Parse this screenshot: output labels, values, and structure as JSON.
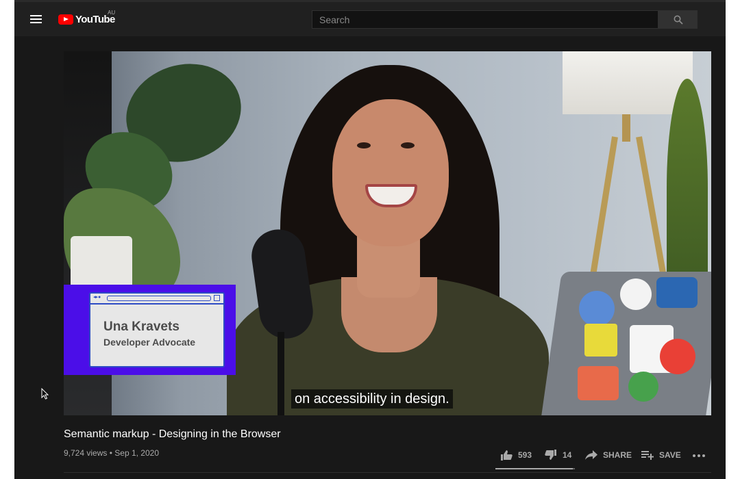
{
  "header": {
    "logo_text": "YouTube",
    "country_code": "AU",
    "search_placeholder": "Search"
  },
  "video": {
    "lower_third": {
      "name": "Una Kravets",
      "role": "Developer Advocate"
    },
    "caption": "on accessibility in design.",
    "title": "Semantic markup - Designing in the Browser",
    "views": "9,724 views",
    "date": "Sep 1, 2020",
    "separator": "•"
  },
  "actions": {
    "likes": "593",
    "dislikes": "14",
    "share_label": "SHARE",
    "save_label": "SAVE",
    "like_ratio": 0.977
  },
  "icons": [
    "menu-icon",
    "youtube-logo-icon",
    "search-icon",
    "thumbs-up-icon",
    "thumbs-down-icon",
    "share-icon",
    "playlist-add-icon",
    "more-icon",
    "mouse-pointer-icon"
  ],
  "colors": {
    "background": "#181818",
    "masthead": "#202020",
    "brand_red": "#ff0000",
    "nameplate_purple": "#4b0ee8"
  }
}
